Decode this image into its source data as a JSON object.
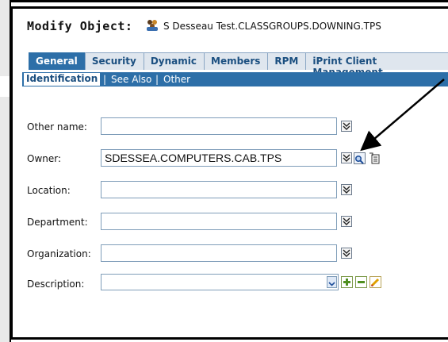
{
  "header": {
    "title_label": "Modify Object:",
    "object_name": "S Desseau Test.CLASSGROUPS.DOWNING.TPS"
  },
  "tabs": [
    {
      "label": "General"
    },
    {
      "label": "Security"
    },
    {
      "label": "Dynamic"
    },
    {
      "label": "Members"
    },
    {
      "label": "RPM"
    },
    {
      "label": "iPrint Client Management"
    }
  ],
  "subtabs": {
    "identification": "Identification",
    "sep1": "|",
    "see_also": "See Also",
    "sep2": "|",
    "other": "Other"
  },
  "form": {
    "other_name": {
      "label": "Other name:",
      "value": ""
    },
    "owner": {
      "label": "Owner:",
      "value": "SDESSEA.COMPUTERS.CAB.TPS"
    },
    "location": {
      "label": "Location:",
      "value": ""
    },
    "department": {
      "label": "Department:",
      "value": ""
    },
    "organization": {
      "label": "Organization:",
      "value": ""
    },
    "description": {
      "label": "Description:",
      "value": ""
    }
  },
  "icons": {
    "history": "history-dropdown-icon",
    "browse": "browse-magnifier-icon",
    "object_selector": "object-selector-icon",
    "add": "add-icon",
    "remove": "remove-icon",
    "edit": "edit-pencil-icon"
  },
  "colors": {
    "accent": "#2d6fa8",
    "tab_text": "#1b4f80"
  }
}
